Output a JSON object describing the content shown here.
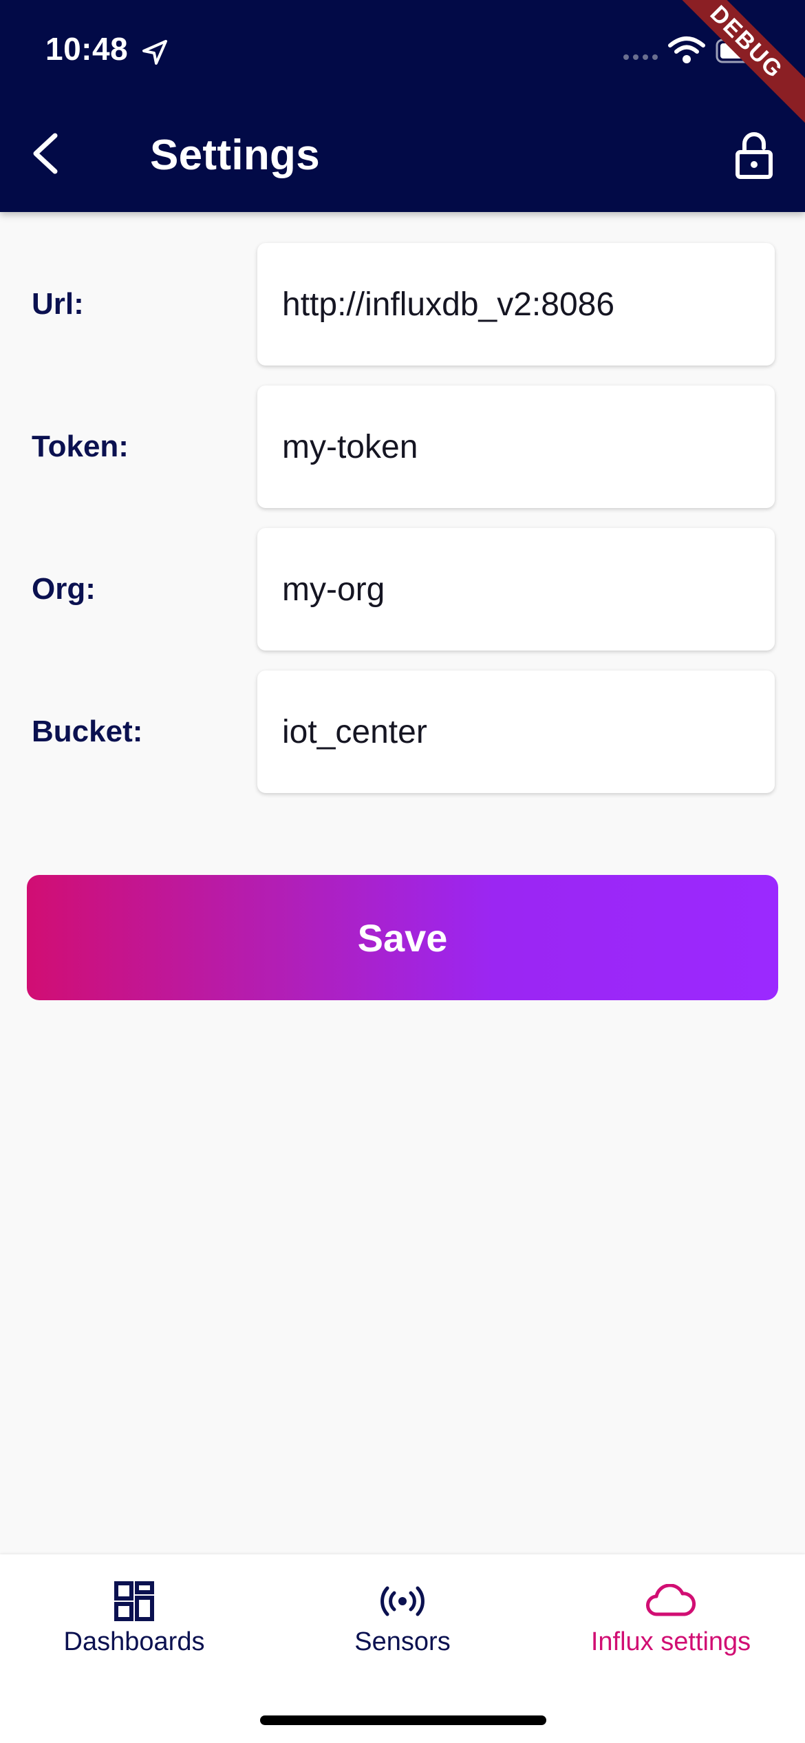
{
  "status_bar": {
    "time": "10:48",
    "debug_banner": "DEBUG"
  },
  "app_bar": {
    "title": "Settings"
  },
  "form": {
    "fields": [
      {
        "label": "Url:",
        "value": "http://influxdb_v2:8086"
      },
      {
        "label": "Token:",
        "value": "my-token"
      },
      {
        "label": "Org:",
        "value": "my-org"
      },
      {
        "label": "Bucket:",
        "value": "iot_center"
      }
    ],
    "save_label": "Save"
  },
  "bottom_nav": {
    "items": [
      {
        "label": "Dashboards",
        "icon": "dashboard-icon",
        "active": false
      },
      {
        "label": "Sensors",
        "icon": "sensors-icon",
        "active": false
      },
      {
        "label": "Influx settings",
        "icon": "cloud-icon",
        "active": true
      }
    ]
  },
  "colors": {
    "app_bar": "#020a47",
    "accent": "#d10e73",
    "gradient_end": "#9b29ff",
    "background": "#f9f9f9"
  }
}
